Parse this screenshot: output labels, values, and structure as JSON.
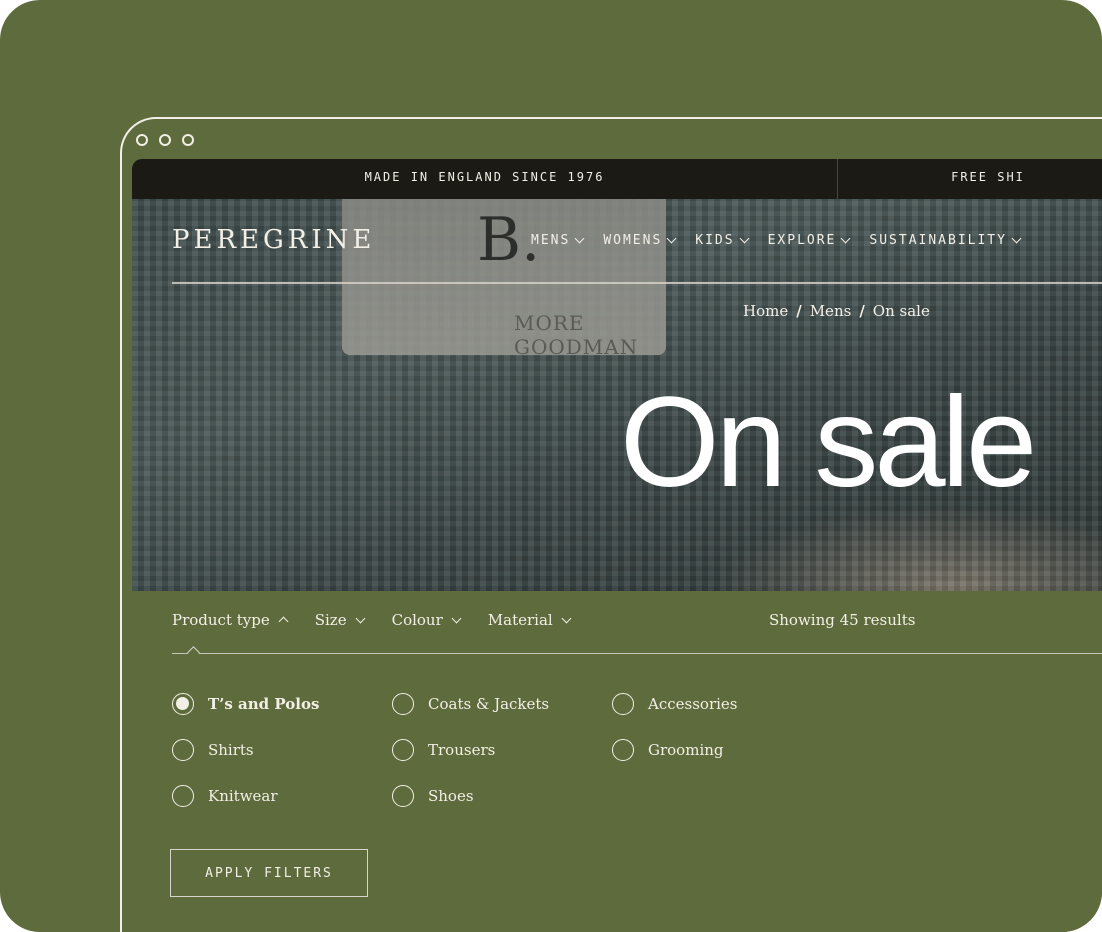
{
  "announcement": {
    "left": "MADE IN ENGLAND SINCE 1976",
    "right": "FREE SHI"
  },
  "brand": {
    "logo": "PEREGRINE"
  },
  "nav": {
    "items": [
      {
        "label": "MENS"
      },
      {
        "label": "WOMENS"
      },
      {
        "label": "KIDS"
      },
      {
        "label": "EXPLORE"
      },
      {
        "label": "SUSTAINABILITY"
      }
    ]
  },
  "breadcrumb": {
    "items": [
      "Home",
      "Mens",
      "On sale"
    ],
    "separator": "/"
  },
  "hero": {
    "title": "On sale",
    "tag_letter": "B.",
    "tag_text": "MORE GOODMAN"
  },
  "filters": {
    "items": [
      {
        "label": "Product type",
        "open": true
      },
      {
        "label": "Size",
        "open": false
      },
      {
        "label": "Colour",
        "open": false
      },
      {
        "label": "Material",
        "open": false
      }
    ],
    "results": "Showing 45 results"
  },
  "product_types": [
    {
      "label": "T’s and Polos",
      "selected": true
    },
    {
      "label": "Shirts",
      "selected": false
    },
    {
      "label": "Knitwear",
      "selected": false
    },
    {
      "label": "Coats & Jackets",
      "selected": false
    },
    {
      "label": "Trousers",
      "selected": false
    },
    {
      "label": "Shoes",
      "selected": false
    },
    {
      "label": "Accessories",
      "selected": false
    },
    {
      "label": "Grooming",
      "selected": false
    }
  ],
  "apply_button": {
    "label": "APPLY FILTERS"
  },
  "colors": {
    "background": "#5e6b3c",
    "announcement_bar": "#1c1a15",
    "text": "#f2efe6"
  }
}
